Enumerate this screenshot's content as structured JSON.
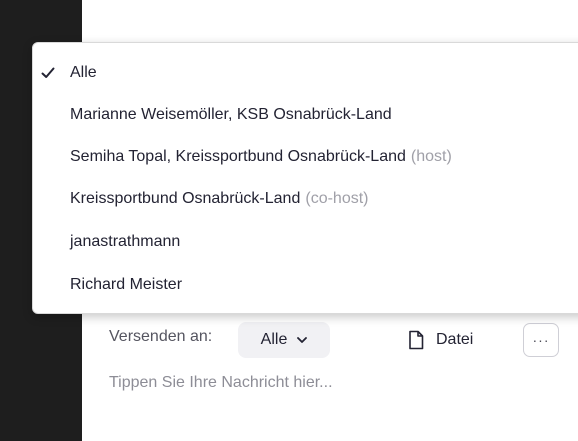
{
  "recipient_menu": {
    "items": [
      {
        "name": "Alle",
        "role": "",
        "selected": true
      },
      {
        "name": "Marianne Weisemöller, KSB Osnabrück-Land",
        "role": "",
        "selected": false
      },
      {
        "name": "Semiha Topal, Kreissportbund Osnabrück-Land",
        "role": "(host)",
        "selected": false
      },
      {
        "name": "Kreissportbund Osnabrück-Land",
        "role": "(co-host)",
        "selected": false
      },
      {
        "name": "janastrathmann",
        "role": "",
        "selected": false
      },
      {
        "name": "Richard Meister",
        "role": "",
        "selected": false
      }
    ],
    "check_icon": "checkmark-icon"
  },
  "footer": {
    "send_to_label": "Versenden an:",
    "recipient_value": "Alle",
    "recipient_chevron_icon": "chevron-down-icon",
    "file_label": "Datei",
    "file_icon": "file-icon",
    "more_label": "···",
    "message_placeholder": "Tippen Sie Ihre Nachricht hier..."
  },
  "colors": {
    "left_strip": "#1e1e1e",
    "text": "#232333",
    "role_text": "#a0a0a8",
    "placeholder": "#8d8d96",
    "select_bg": "#f1f1f4"
  }
}
